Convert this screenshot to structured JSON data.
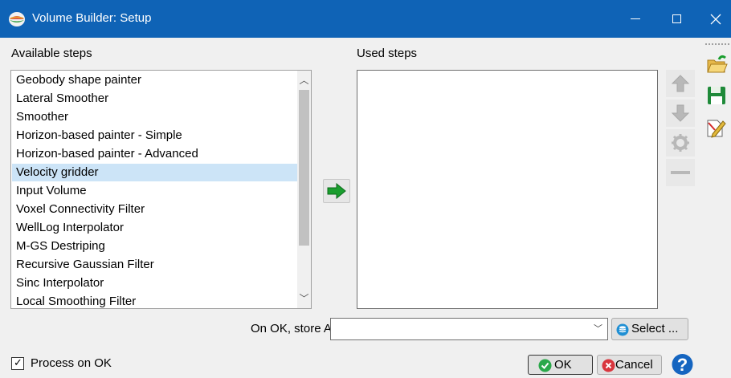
{
  "window": {
    "title": "Volume Builder: Setup",
    "icon": "app-logo-icon",
    "controls": {
      "minimize": "—",
      "maximize": "☐",
      "close": "✕"
    }
  },
  "available": {
    "label": "Available steps",
    "items": [
      "Geobody shape painter",
      "Lateral Smoother",
      "Smoother",
      "Horizon-based painter - Simple",
      "Horizon-based painter - Advanced",
      "Velocity gridder",
      "Input Volume",
      "Voxel Connectivity Filter",
      "WellLog Interpolator",
      "M-GS Destriping",
      "Recursive Gaussian Filter",
      "Sinc Interpolator",
      "Local Smoothing Filter"
    ],
    "selected_index": 5
  },
  "used": {
    "label": "Used steps",
    "items": []
  },
  "store": {
    "label": "On OK, store As",
    "value": "",
    "select_label": "Select ..."
  },
  "footer": {
    "process_label": "Process on OK",
    "process_checked": true,
    "ok_label": "OK",
    "cancel_label": "Cancel",
    "help_label": "?"
  },
  "colors": {
    "titlebar": "#0f63b6",
    "selection": "#cce4f7",
    "arrow_green": "#1a9e2e",
    "cancel_red": "#d9363e",
    "help_blue": "#1565c0"
  }
}
